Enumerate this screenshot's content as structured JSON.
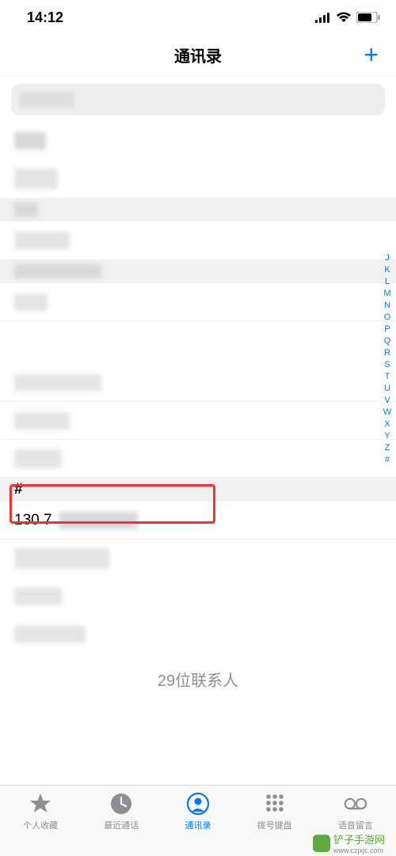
{
  "status": {
    "time": "14:12"
  },
  "nav": {
    "title": "通讯录",
    "add_label": "+"
  },
  "sections": {
    "hash_label": "#",
    "highlighted_prefix": "130 7"
  },
  "footer": {
    "count_text": "29位联系人"
  },
  "index_letters": [
    "J",
    "K",
    "L",
    "M",
    "N",
    "O",
    "P",
    "Q",
    "R",
    "S",
    "T",
    "U",
    "V",
    "W",
    "X",
    "Y",
    "Z",
    "#"
  ],
  "tabs": {
    "favorites": "个人收藏",
    "recents": "最近通话",
    "contacts": "通讯录",
    "keypad": "拨号键盘",
    "voicemail": "语音留言"
  },
  "watermark": {
    "text": "铲子手游网",
    "url": "www.czjxjc.com"
  }
}
